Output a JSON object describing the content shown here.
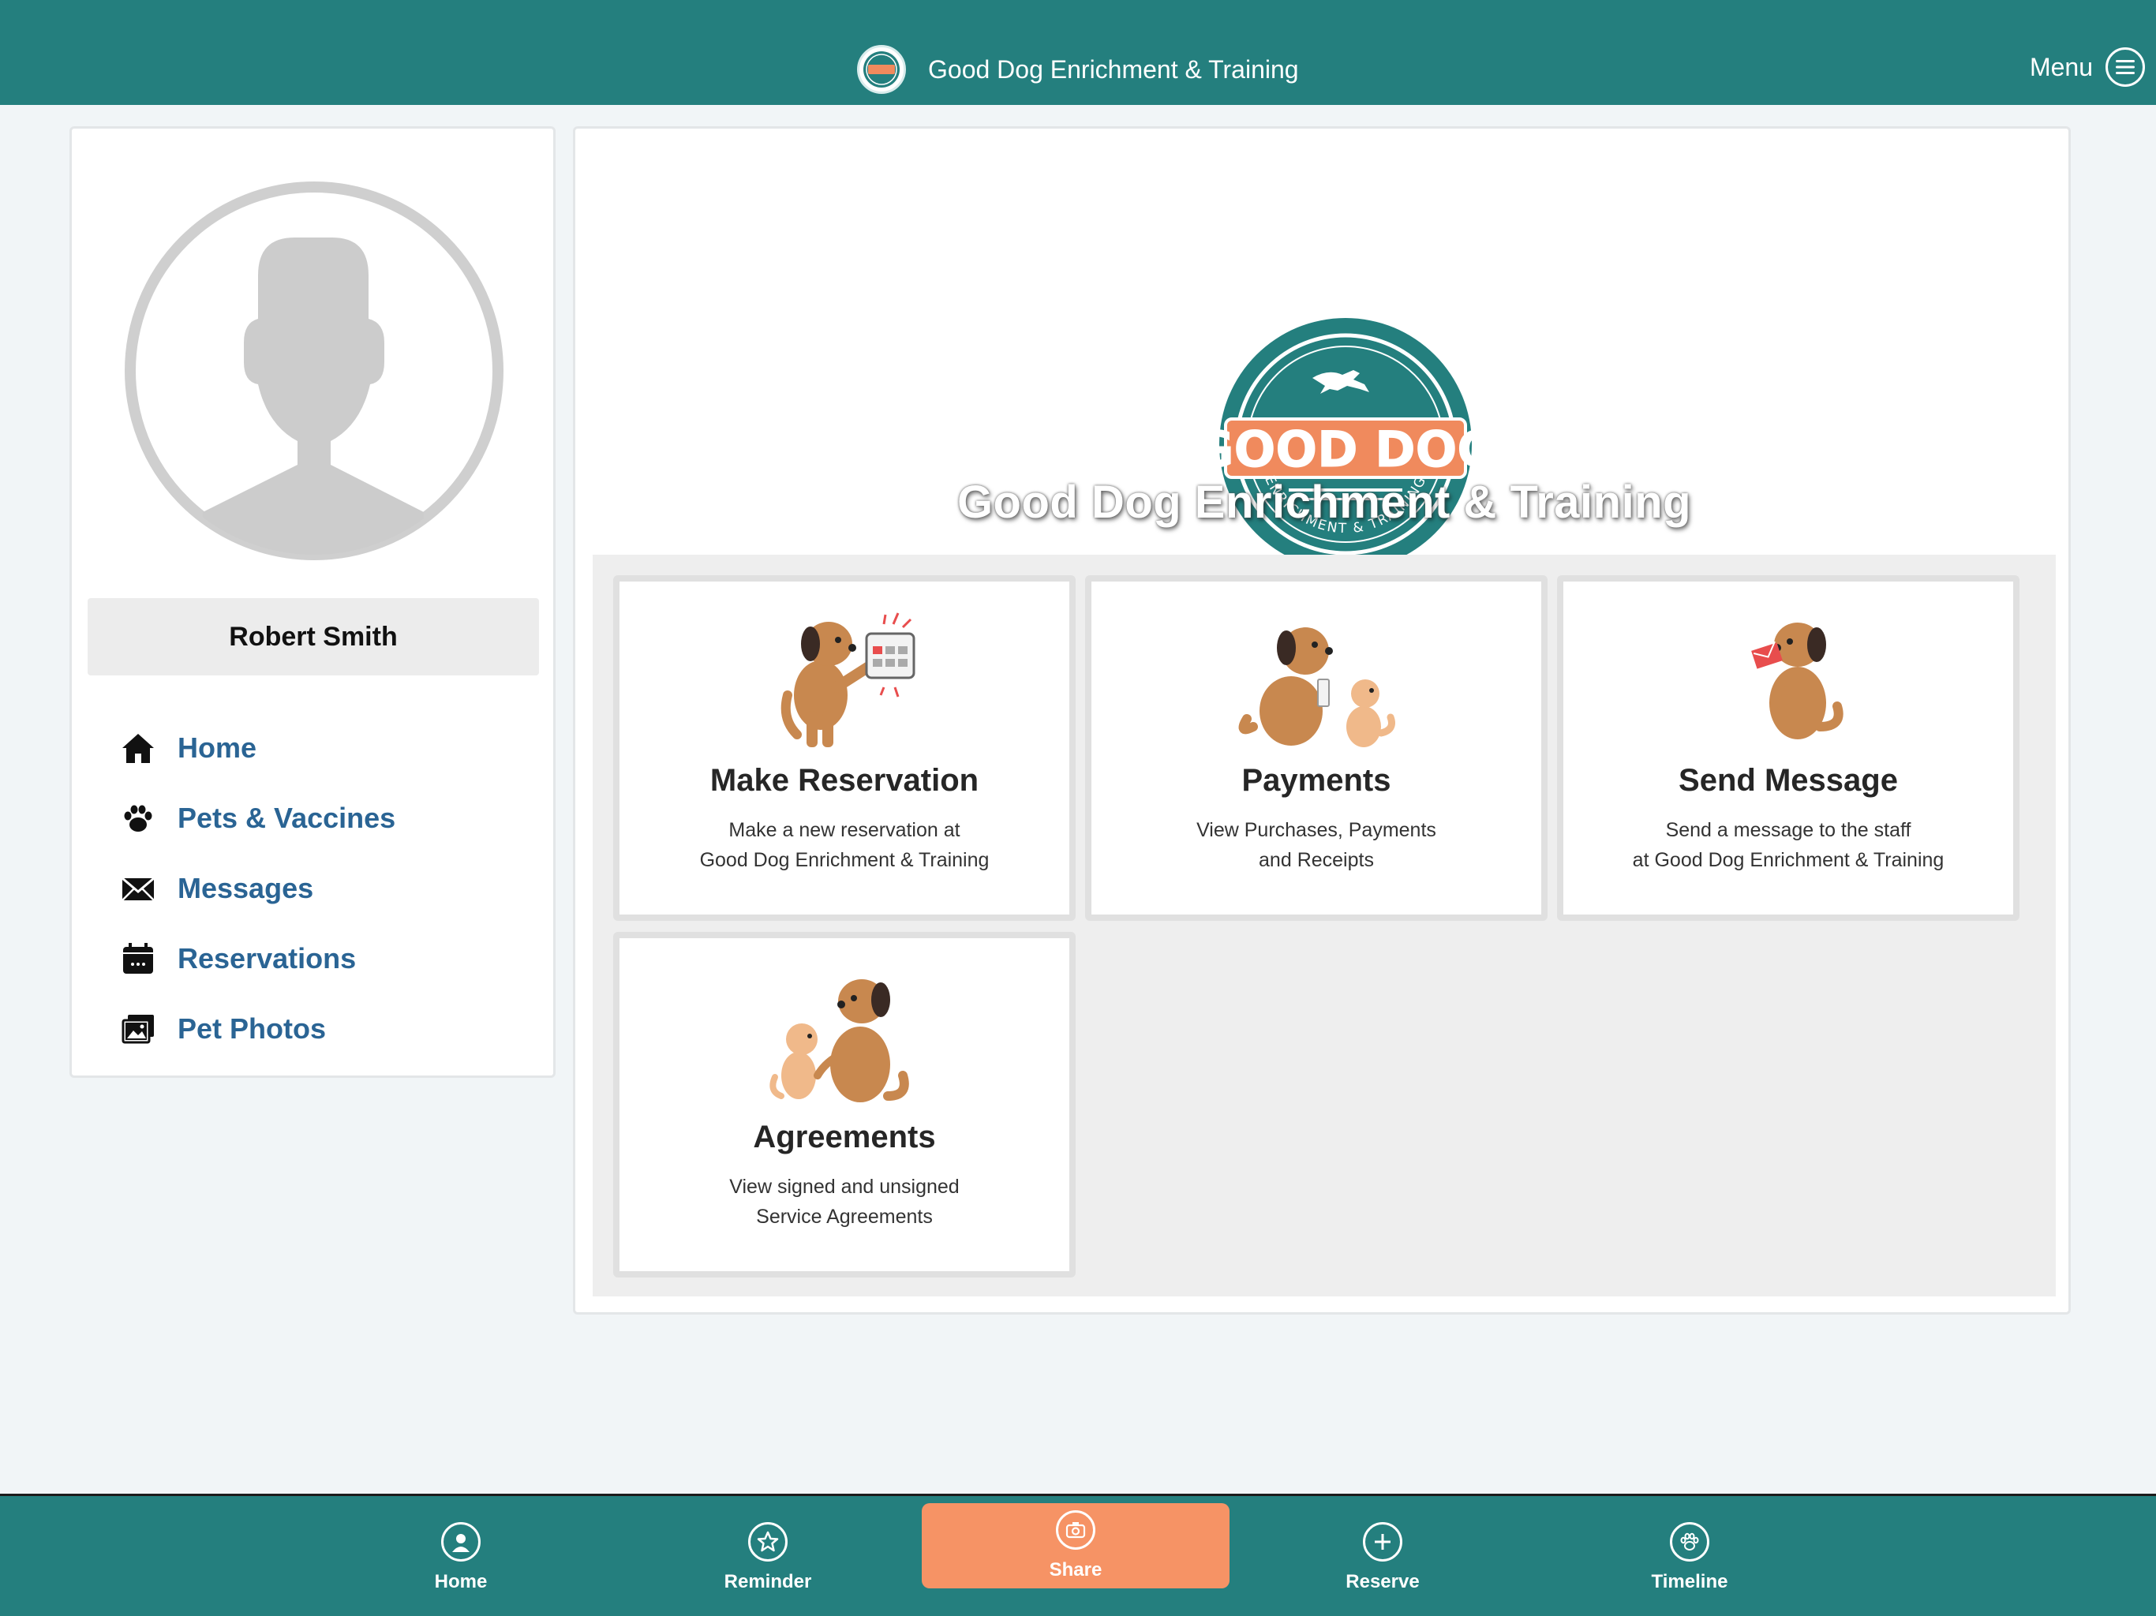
{
  "header": {
    "title": "Good Dog Enrichment & Training",
    "menu_label": "Menu"
  },
  "profile": {
    "name": "Robert Smith",
    "nav": [
      {
        "label": "Home",
        "icon": "home-icon"
      },
      {
        "label": "Pets & Vaccines",
        "icon": "paw-icon"
      },
      {
        "label": "Messages",
        "icon": "envelope-icon"
      },
      {
        "label": "Reservations",
        "icon": "calendar-icon"
      },
      {
        "label": "Pet Photos",
        "icon": "photos-icon"
      }
    ]
  },
  "hero": {
    "logo_text_top": "GOOD DOG",
    "logo_text_bottom": "ENRICHMENT & TRAINING",
    "title": "Good Dog Enrichment & Training"
  },
  "tiles": [
    {
      "title": "Make Reservation",
      "desc_line1": "Make a new reservation at",
      "desc_line2": "Good Dog Enrichment & Training"
    },
    {
      "title": "Payments",
      "desc_line1": "View Purchases, Payments",
      "desc_line2": "and Receipts"
    },
    {
      "title": "Send Message",
      "desc_line1": "Send a message to the staff",
      "desc_line2": "at Good Dog Enrichment & Training"
    },
    {
      "title": "Agreements",
      "desc_line1": "View signed and unsigned",
      "desc_line2": "Service Agreements"
    }
  ],
  "bottom_tabs": [
    {
      "label": "Home",
      "icon": "user-circle-icon"
    },
    {
      "label": "Reminder",
      "icon": "star-icon"
    },
    {
      "label": "Share",
      "icon": "camera-icon"
    },
    {
      "label": "Reserve",
      "icon": "plus-icon"
    },
    {
      "label": "Timeline",
      "icon": "paw-icon"
    }
  ],
  "colors": {
    "brand_teal": "#247f7e",
    "accent_orange": "#f69365",
    "nav_link": "#2a6494"
  }
}
